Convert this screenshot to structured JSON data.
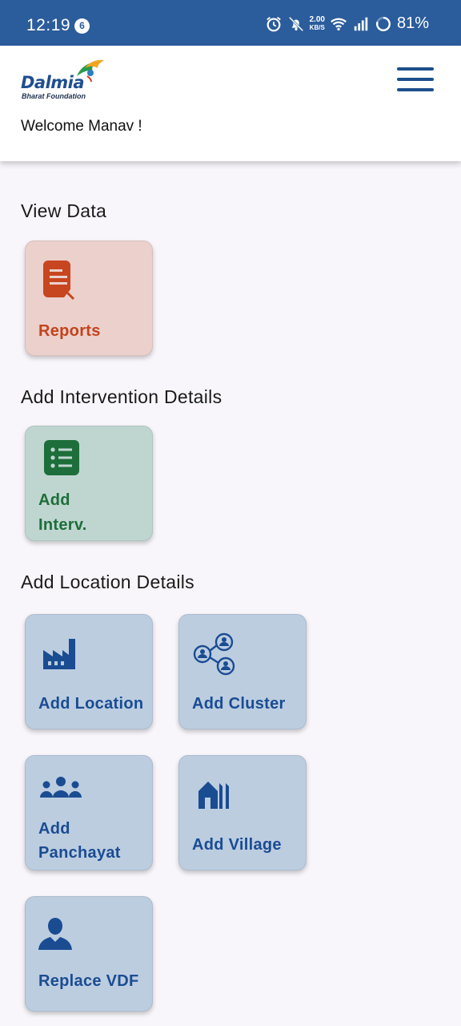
{
  "status_bar": {
    "time": "12:19",
    "notification_count": "6",
    "net_speed_value": "2.00",
    "net_speed_unit": "KB/S",
    "battery": "81%"
  },
  "header": {
    "logo_word": "Dalmia",
    "logo_sub": "Bharat Foundation",
    "welcome": "Welcome Manav !"
  },
  "sections": {
    "view_data": "View Data",
    "add_intervention": "Add Intervention Details",
    "add_location": "Add Location Details"
  },
  "tiles": {
    "reports": "Reports",
    "add_interv": [
      "Add",
      "Interv."
    ],
    "add_location": "Add Location",
    "add_cluster": "Add Cluster",
    "add_panchayat": [
      "Add",
      "Panchayat"
    ],
    "add_village": "Add Village",
    "replace_vdf": "Replace VDF"
  },
  "colors": {
    "status_bar": "#2b5c9c",
    "reports_tile": "#ecd0cc",
    "reports_accent": "#c1441c",
    "intervention_tile": "#bfd6d0",
    "intervention_accent": "#1d6e3a",
    "location_tile": "#bccde0",
    "location_accent": "#1a4c92"
  }
}
